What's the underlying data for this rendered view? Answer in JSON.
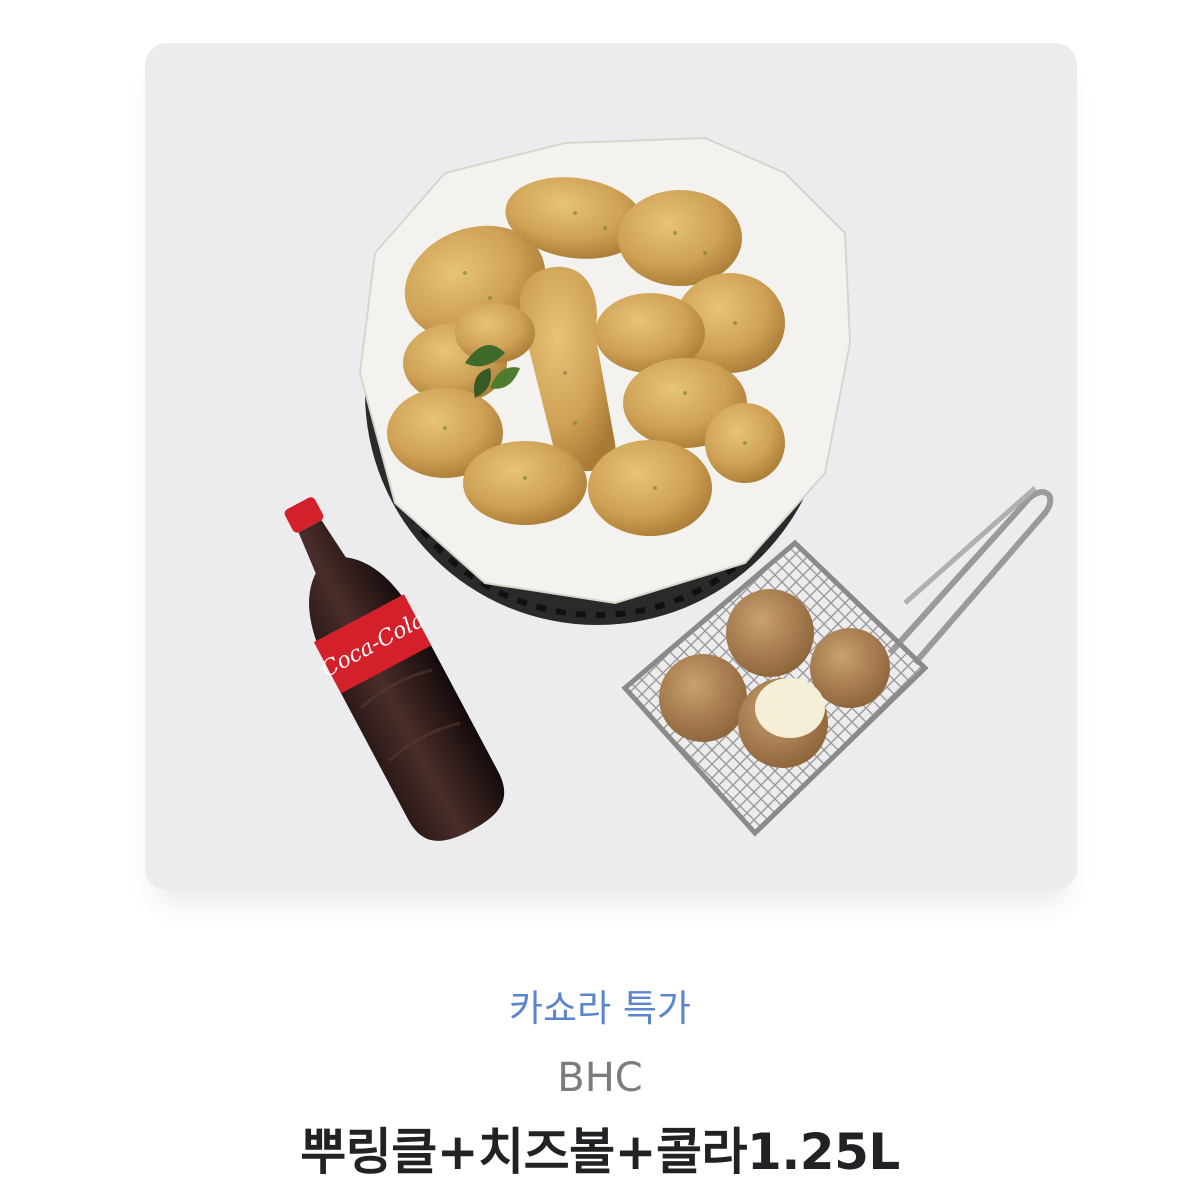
{
  "product": {
    "image_alt": "BHC 뿌링클 치킨, 치즈볼, 코카콜라 1.25L 세트",
    "bottle_label": "Coca-Cola",
    "promo_label": "카쇼라 특가",
    "brand": "BHC",
    "title": "뿌링클+치즈볼+콜라1.25L"
  },
  "colors": {
    "card_background": "#ececef",
    "promo": "#5b86cf",
    "brand": "#7c7c80",
    "title": "#222226",
    "cola_red": "#d3202a"
  },
  "icons": {
    "product_image": "food-photo"
  }
}
